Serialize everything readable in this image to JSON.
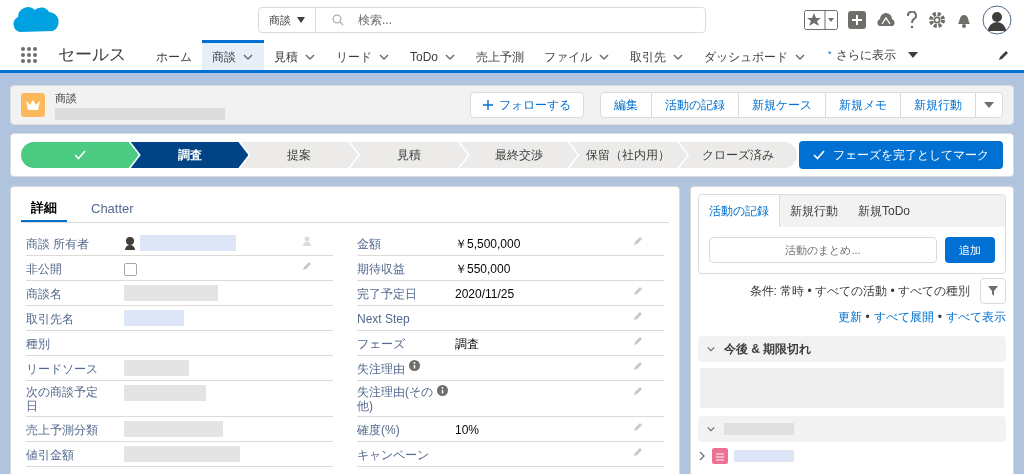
{
  "header": {
    "search": {
      "scope": "商談",
      "placeholder": "検索..."
    }
  },
  "nav": {
    "app_name": "セールス",
    "tabs": [
      {
        "label": "ホーム",
        "selected": false,
        "has_menu": false
      },
      {
        "label": "商談",
        "selected": true,
        "has_menu": true
      },
      {
        "label": "見積",
        "selected": false,
        "has_menu": true
      },
      {
        "label": "リード",
        "selected": false,
        "has_menu": true
      },
      {
        "label": "ToDo",
        "selected": false,
        "has_menu": true
      },
      {
        "label": "売上予測",
        "selected": false,
        "has_menu": false
      },
      {
        "label": "ファイル",
        "selected": false,
        "has_menu": true
      },
      {
        "label": "取引先",
        "selected": false,
        "has_menu": true
      },
      {
        "label": "ダッシュボード",
        "selected": false,
        "has_menu": true
      }
    ],
    "more": {
      "mark": "*",
      "label": "さらに表示"
    }
  },
  "record": {
    "object_label": "商談",
    "follow_button": "フォローする",
    "actions": [
      "編集",
      "活動の記録",
      "新規ケース",
      "新規メモ",
      "新規行動"
    ]
  },
  "path": {
    "steps": [
      {
        "completed": true,
        "selected": false
      },
      {
        "label": "調査",
        "completed": false,
        "selected": true
      },
      {
        "label": "提案",
        "completed": false,
        "selected": false
      },
      {
        "label": "見積",
        "completed": false,
        "selected": false
      },
      {
        "label": "最終交渉",
        "completed": false,
        "selected": false
      },
      {
        "label": "保留（社内用）",
        "completed": false,
        "selected": false
      },
      {
        "label": "クローズ済み",
        "completed": false,
        "selected": false
      }
    ],
    "mark_button": "フェーズを完了としてマーク"
  },
  "details": {
    "tabs": [
      {
        "label": "詳細",
        "selected": true
      },
      {
        "label": "Chatter",
        "selected": false
      }
    ],
    "left": [
      {
        "label": "商談 所有者",
        "kind": "owner",
        "editable": false
      },
      {
        "label": "非公開",
        "kind": "checkbox",
        "checked": false,
        "editable": true
      },
      {
        "label": "商談名",
        "kind": "redacted",
        "editable": false
      },
      {
        "label": "取引先名",
        "kind": "redacted_link",
        "editable": false
      },
      {
        "label": "種別",
        "kind": "empty",
        "editable": false
      },
      {
        "label": "リードソース",
        "kind": "redacted",
        "editable": false
      },
      {
        "label": "次の商談予定日",
        "kind": "redacted",
        "editable": false,
        "tall": true
      },
      {
        "label": "売上予測分類",
        "kind": "redacted",
        "editable": false
      },
      {
        "label": "値引金額",
        "kind": "redacted",
        "editable": false
      }
    ],
    "right": [
      {
        "label": "金額",
        "kind": "text",
        "value": "￥5,500,000",
        "editable": true
      },
      {
        "label": "期待収益",
        "kind": "text",
        "value": "￥550,000",
        "editable": false
      },
      {
        "label": "完了予定日",
        "kind": "text",
        "value": "2020/11/25",
        "editable": true
      },
      {
        "label": "Next Step",
        "kind": "empty",
        "editable": true
      },
      {
        "label": "フェーズ",
        "kind": "text",
        "value": "調査",
        "editable": true
      },
      {
        "label": "失注理由",
        "kind": "empty",
        "editable": true,
        "info": true
      },
      {
        "label": "失注理由(その他)",
        "kind": "empty",
        "editable": true,
        "info": true,
        "tall": true
      },
      {
        "label": "確度(%)",
        "kind": "text",
        "value": "10%",
        "editable": true
      },
      {
        "label": "キャンペーン",
        "kind": "empty",
        "editable": true
      }
    ]
  },
  "activity": {
    "tabs": [
      {
        "label": "活動の記録",
        "selected": true
      },
      {
        "label": "新規行動",
        "selected": false
      },
      {
        "label": "新規ToDo",
        "selected": false
      }
    ],
    "input_placeholder": "活動のまとめ...",
    "add_button": "追加",
    "filter_text": "条件: 常時 • すべての活動 • すべての種別",
    "links": [
      "更新",
      "すべて展開",
      "すべて表示"
    ],
    "link_separator": "•",
    "sections": [
      {
        "title": "今後 & 期限切れ",
        "expanded": true
      },
      {
        "title_redacted": true,
        "expanded": true
      }
    ]
  }
}
